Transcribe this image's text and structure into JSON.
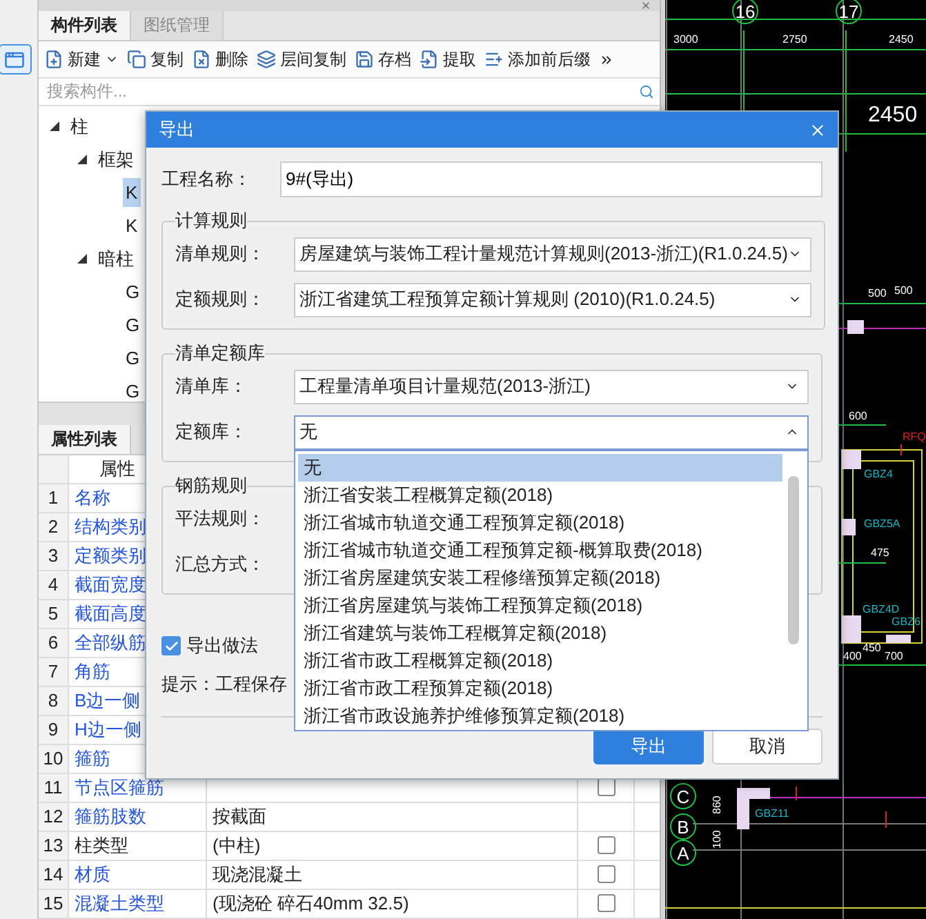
{
  "component_panel": {
    "tabs": [
      {
        "label": "构件列表",
        "selected": true
      },
      {
        "label": "图纸管理",
        "selected": false
      }
    ],
    "toolbar": [
      {
        "label": "新建",
        "kind": "new"
      },
      {
        "label": "复制",
        "kind": "copy"
      },
      {
        "label": "删除",
        "kind": "delete"
      },
      {
        "label": "层间复制",
        "kind": "layers"
      },
      {
        "label": "存档",
        "kind": "save"
      },
      {
        "label": "提取",
        "kind": "extract"
      },
      {
        "label": "添加前后缀",
        "kind": "affix"
      }
    ],
    "search": {
      "placeholder": "搜索构件..."
    },
    "tree": [
      {
        "label": "柱",
        "expanded": true,
        "children": [
          {
            "label": "框架",
            "expanded": true,
            "children": [
              {
                "label": "K",
                "selected": true
              },
              {
                "label": "K",
                "selected": false
              }
            ]
          },
          {
            "label": "暗柱",
            "expanded": true,
            "children": [
              {
                "label": "G",
                "selected": false
              },
              {
                "label": "G",
                "selected": false
              },
              {
                "label": "G",
                "selected": false
              },
              {
                "label": "G",
                "selected": false
              }
            ]
          }
        ]
      }
    ]
  },
  "property_panel": {
    "tabs": [
      {
        "label": "属性列表",
        "selected": true
      }
    ],
    "columns": [
      "属性"
    ],
    "rows": [
      {
        "index": "1",
        "name": "名称",
        "public": true
      },
      {
        "index": "2",
        "name": "结构类别",
        "public": true
      },
      {
        "index": "3",
        "name": "定额类别",
        "public": true
      },
      {
        "index": "4",
        "name": "截面宽度",
        "public": true
      },
      {
        "index": "5",
        "name": "截面高度",
        "public": true
      },
      {
        "index": "6",
        "name": "全部纵筋",
        "public": true
      },
      {
        "index": "7",
        "name": "角筋",
        "public": true
      },
      {
        "index": "8",
        "name": "B边一侧",
        "public": true
      },
      {
        "index": "9",
        "name": "H边一侧",
        "public": true
      },
      {
        "index": "10",
        "name": "箍筋",
        "public": true
      },
      {
        "index": "11",
        "name": "节点区箍筋",
        "public": true,
        "value": "",
        "checked": false
      },
      {
        "index": "12",
        "name": "箍筋肢数",
        "public": true,
        "value": "按截面"
      },
      {
        "index": "13",
        "name": "柱类型",
        "public": false,
        "value": "(中柱)",
        "checked": false
      },
      {
        "index": "14",
        "name": "材质",
        "public": true,
        "value": "现浇混凝土",
        "checked": false
      },
      {
        "index": "15",
        "name": "混凝土类型",
        "public": true,
        "value": "(现浇砼 碎石40mm 32.5)",
        "checked": false
      }
    ]
  },
  "dialog": {
    "title": "导出",
    "project_name": {
      "label": "工程名称：",
      "value": "9#(导出)"
    },
    "groups": [
      {
        "legend": "计算规则",
        "fields": [
          {
            "label": "清单规则：",
            "value": "房屋建筑与装饰工程计量规范计算规则(2013-浙江)(R1.0.24.5)",
            "open": false
          },
          {
            "label": "定额规则：",
            "value": "浙江省建筑工程预算定额计算规则 (2010)(R1.0.24.5)",
            "open": false
          }
        ]
      },
      {
        "legend": "清单定额库",
        "fields": [
          {
            "label": "清单库：",
            "value": "工程量清单项目计量规范(2013-浙江)",
            "open": false
          },
          {
            "label": "定额库：",
            "value": "无",
            "open": true,
            "options": [
              {
                "label": "无",
                "selected": true
              },
              {
                "label": "浙江省安装工程概算定额(2018)",
                "selected": false
              },
              {
                "label": "浙江省城市轨道交通工程预算定额(2018)",
                "selected": false
              },
              {
                "label": "浙江省城市轨道交通工程预算定额-概算取费(2018)",
                "selected": false
              },
              {
                "label": "浙江省房屋建筑安装工程修缮预算定额(2018)",
                "selected": false
              },
              {
                "label": "浙江省房屋建筑与装饰工程预算定额(2018)",
                "selected": false
              },
              {
                "label": "浙江省建筑与装饰工程概算定额(2018)",
                "selected": false
              },
              {
                "label": "浙江省市政工程概算定额(2018)",
                "selected": false
              },
              {
                "label": "浙江省市政工程预算定额(2018)",
                "selected": false
              },
              {
                "label": "浙江省市政设施养护维修预算定额(2018)",
                "selected": false
              }
            ]
          }
        ]
      },
      {
        "legend": "钢筋规则",
        "fields": [
          {
            "label": "平法规则："
          },
          {
            "label": "汇总方式："
          }
        ]
      }
    ],
    "export_method": {
      "label": "导出做法",
      "checked": true
    },
    "hint": "提示：工程保存",
    "buttons": [
      {
        "label": "导出",
        "primary": true
      },
      {
        "label": "取消",
        "primary": false
      }
    ]
  },
  "cad": {
    "labels": [
      {
        "text": "16",
        "kind": "axis"
      },
      {
        "text": "17",
        "kind": "axis"
      },
      {
        "text": "3000",
        "kind": "dim"
      },
      {
        "text": "2750",
        "kind": "dim"
      },
      {
        "text": "2450",
        "kind": "dim"
      },
      {
        "text": "2450",
        "kind": "big"
      },
      {
        "text": "500",
        "kind": "dim"
      },
      {
        "text": "500",
        "kind": "dim"
      },
      {
        "text": "600",
        "kind": "dim"
      },
      {
        "text": "RFQ",
        "kind": "mark"
      },
      {
        "text": "GBZ4",
        "kind": "tag"
      },
      {
        "text": "GBZ5A",
        "kind": "tag"
      },
      {
        "text": "475",
        "kind": "dim"
      },
      {
        "text": "GBZ4D",
        "kind": "tag"
      },
      {
        "text": "GBZ6",
        "kind": "tag"
      },
      {
        "text": "450",
        "kind": "dim"
      },
      {
        "text": "400",
        "kind": "dim"
      },
      {
        "text": "700",
        "kind": "dim"
      },
      {
        "text": "C",
        "kind": "axis"
      },
      {
        "text": "860",
        "kind": "vdim"
      },
      {
        "text": "GBZ11",
        "kind": "tag"
      },
      {
        "text": "B",
        "kind": "axis"
      },
      {
        "text": "100",
        "kind": "vdim"
      },
      {
        "text": "A",
        "kind": "axis"
      }
    ]
  }
}
